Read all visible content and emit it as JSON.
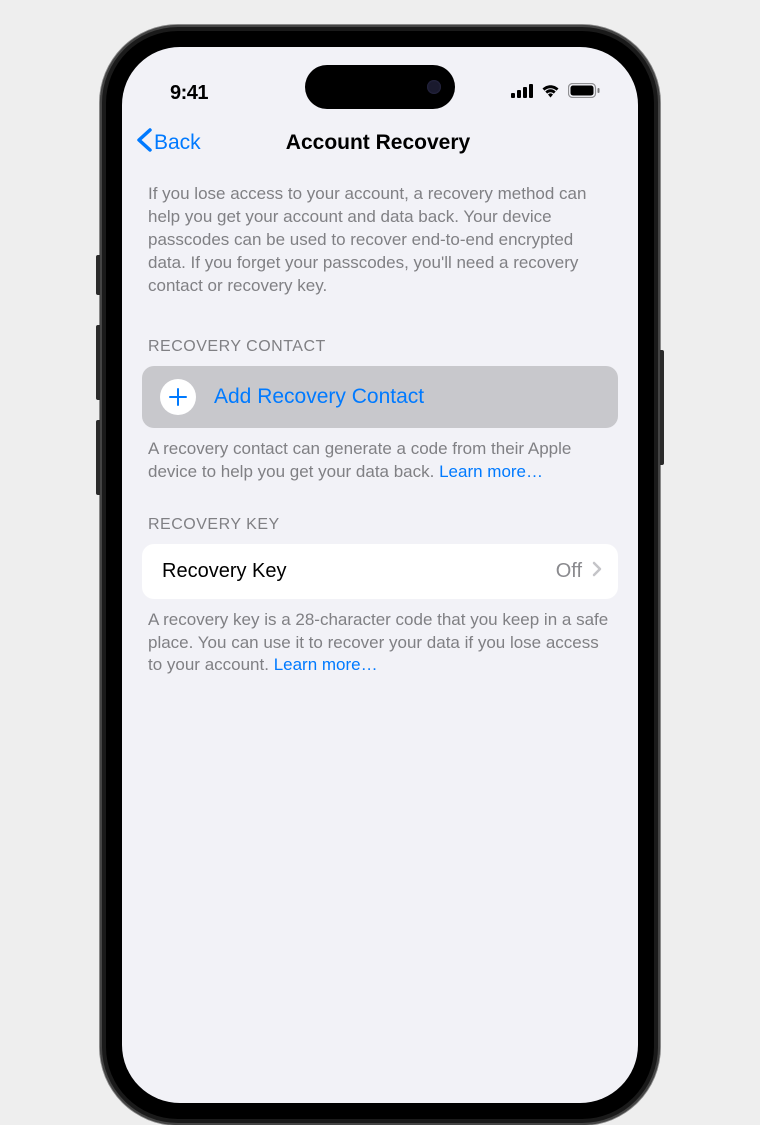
{
  "statusBar": {
    "time": "9:41"
  },
  "nav": {
    "backLabel": "Back",
    "title": "Account Recovery"
  },
  "intro": "If you lose access to your account, a recovery method can help you get your account and data back. Your device passcodes can be used to recover end-to-end encrypted data. If you forget your passcodes, you'll need a recovery contact or recovery key.",
  "recoveryContact": {
    "header": "RECOVERY CONTACT",
    "addLabel": "Add Recovery Contact",
    "footerText": "A recovery contact can generate a code from their Apple device to help you get your data back. ",
    "learnMore": "Learn more…"
  },
  "recoveryKey": {
    "header": "RECOVERY KEY",
    "label": "Recovery Key",
    "value": "Off",
    "footerText": "A recovery key is a 28-character code that you keep in a safe place. You can use it to recover your data if you lose access to your account. ",
    "learnMore": "Learn more…"
  }
}
